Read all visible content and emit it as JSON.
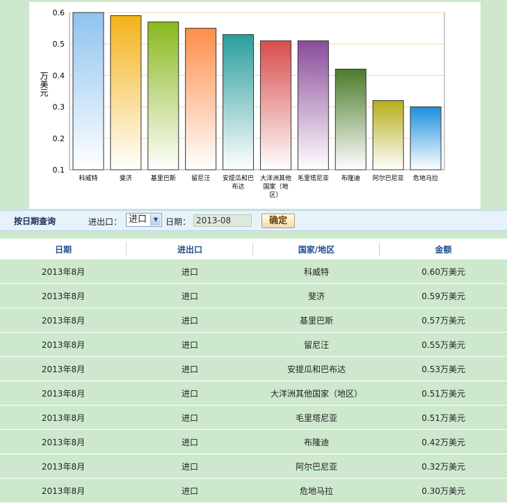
{
  "chart_data": {
    "type": "bar",
    "ylabel": "万美元",
    "ylim": [
      0.1,
      0.6
    ],
    "yticks": [
      "0.1",
      "0.2",
      "0.3",
      "0.4",
      "0.5",
      "0.6"
    ],
    "categories": [
      "科威特",
      "斐济",
      "基里巴斯",
      "留尼汪",
      "安提瓜和巴布达",
      "大洋洲其他国家（地区）",
      "毛里塔尼亚",
      "布隆迪",
      "阿尔巴尼亚",
      "危地马拉"
    ],
    "category_lines": [
      [
        "科威特"
      ],
      [
        "斐济"
      ],
      [
        "基里巴斯"
      ],
      [
        "留尼汪"
      ],
      [
        "安提瓜和巴",
        "布达"
      ],
      [
        "大洋洲其他",
        "国家（地",
        "区）"
      ],
      [
        "毛里塔尼亚"
      ],
      [
        "布隆迪"
      ],
      [
        "阿尔巴尼亚"
      ],
      [
        "危地马拉"
      ]
    ],
    "values": [
      0.6,
      0.59,
      0.57,
      0.55,
      0.53,
      0.51,
      0.51,
      0.42,
      0.32,
      0.3
    ],
    "colors": [
      "#8fc3ef",
      "#f3b21a",
      "#8ab81f",
      "#ff8d4a",
      "#2a9d9d",
      "#d84c4c",
      "#8a4c9a",
      "#4c7a2a",
      "#b5ae1a",
      "#1c8fdc"
    ],
    "grid": true
  },
  "query": {
    "title": "按日期查询",
    "io_label": "进出口：",
    "io_value": "进口",
    "date_label": "日期：",
    "date_value": "2013-08",
    "confirm_label": "确定"
  },
  "table": {
    "headers": [
      "日期",
      "进出口",
      "国家/地区",
      "金额"
    ],
    "rows": [
      [
        "2013年8月",
        "进口",
        "科威特",
        "0.60万美元"
      ],
      [
        "2013年8月",
        "进口",
        "斐济",
        "0.59万美元"
      ],
      [
        "2013年8月",
        "进口",
        "基里巴斯",
        "0.57万美元"
      ],
      [
        "2013年8月",
        "进口",
        "留尼汪",
        "0.55万美元"
      ],
      [
        "2013年8月",
        "进口",
        "安提瓜和巴布达",
        "0.53万美元"
      ],
      [
        "2013年8月",
        "进口",
        "大洋洲其他国家（地区）",
        "0.51万美元"
      ],
      [
        "2013年8月",
        "进口",
        "毛里塔尼亚",
        "0.51万美元"
      ],
      [
        "2013年8月",
        "进口",
        "布隆迪",
        "0.42万美元"
      ],
      [
        "2013年8月",
        "进口",
        "阿尔巴尼亚",
        "0.32万美元"
      ],
      [
        "2013年8月",
        "进口",
        "危地马拉",
        "0.30万美元"
      ]
    ]
  }
}
